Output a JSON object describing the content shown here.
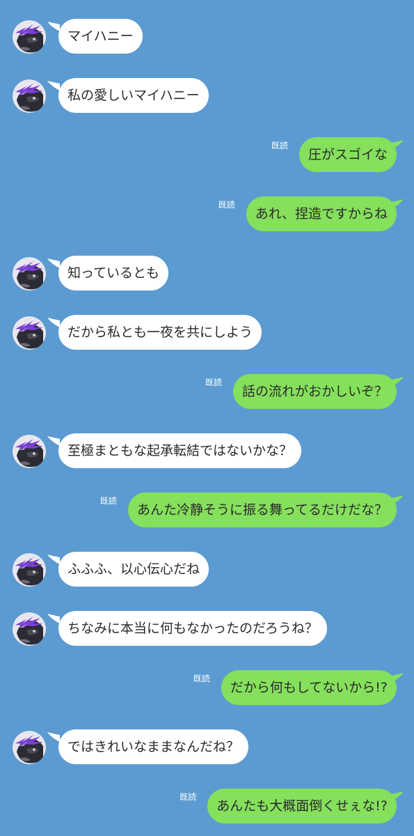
{
  "theme": {
    "background": "#5b9bd1",
    "incoming_bubble": "#ffffff",
    "outgoing_bubble": "#85e05c",
    "text": "#2a2a2a"
  },
  "avatar_icon": "purple-haired-character-avatar",
  "messages": [
    {
      "side": "in",
      "text": "マイハニー"
    },
    {
      "side": "in",
      "text": "私の愛しいマイハニー"
    },
    {
      "side": "out",
      "text": "圧がスゴイな",
      "read": "既読"
    },
    {
      "side": "out",
      "text": "あれ、捏造ですからね",
      "read": "既読"
    },
    {
      "side": "in",
      "text": "知っているとも"
    },
    {
      "side": "in",
      "text": "だから私とも一夜を共にしよう"
    },
    {
      "side": "out",
      "text": "話の流れがおかしいぞ？",
      "read": "既読"
    },
    {
      "side": "in",
      "text": "至極まともな起承転結ではないかな？"
    },
    {
      "side": "out",
      "text": "あんた冷静そうに振る舞ってるだけだな？",
      "read": "既読"
    },
    {
      "side": "in",
      "text": "ふふふ、以心伝心だね"
    },
    {
      "side": "in",
      "text": "ちなみに本当に何もなかったのだろうね？"
    },
    {
      "side": "out",
      "text": "だから何もしてないから!?",
      "read": "既読"
    },
    {
      "side": "in",
      "text": "ではきれいなままなんだね？"
    },
    {
      "side": "out",
      "text": "あんたも大概面倒くせぇな!?",
      "read": "既読"
    }
  ]
}
